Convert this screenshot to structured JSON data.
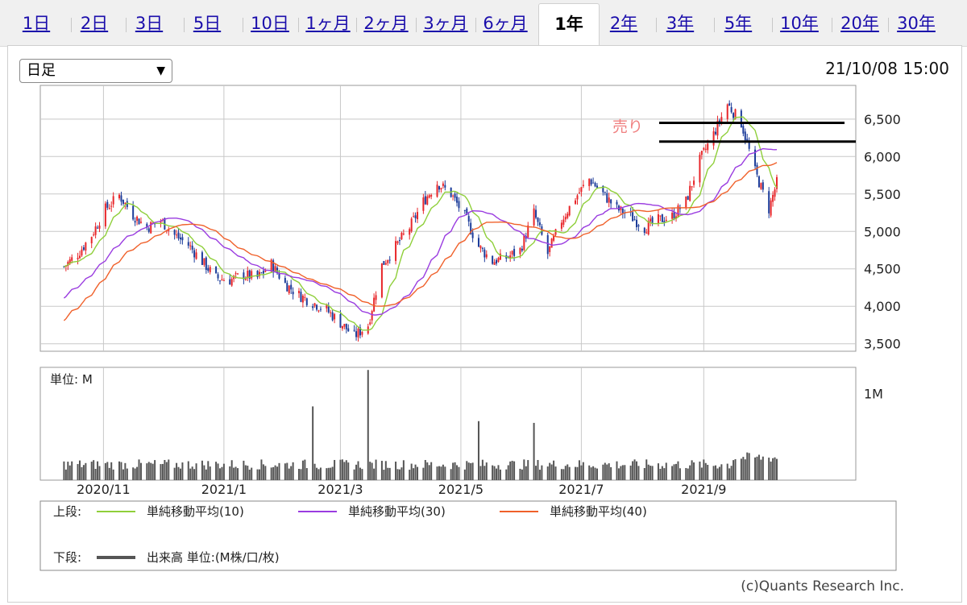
{
  "tabs": [
    "1日",
    "2日",
    "3日",
    "5日",
    "10日",
    "1ヶ月",
    "2ヶ月",
    "3ヶ月",
    "6ヶ月",
    "1年",
    "2年",
    "3年",
    "5年",
    "10年",
    "20年",
    "30年"
  ],
  "active_tab": "1年",
  "period_select": "日足",
  "timestamp": "21/10/08 15:00",
  "copyright": "(c)Quants Research Inc.",
  "colors": {
    "up": "#e8262a",
    "down": "#1c3c9a",
    "ma10": "#8fcf3a",
    "ma30": "#9a3ce0",
    "ma40": "#f0602a",
    "volume": "#555555",
    "annotation": "#f08080"
  },
  "chart_data": {
    "type": "candlestick",
    "price": {
      "ylim": [
        3400,
        6950
      ],
      "yticks": [
        3500,
        4000,
        4500,
        5000,
        5500,
        6000,
        6500
      ],
      "ytick_labels": [
        "3,500",
        "4,000",
        "4,500",
        "5,000",
        "5,500",
        "6,000",
        "6,500"
      ],
      "close_series": [
        [
          "2020-10-12",
          4530
        ],
        [
          "2020-10-19",
          4700
        ],
        [
          "2020-10-26",
          4950
        ],
        [
          "2020-11-02",
          5300
        ],
        [
          "2020-11-09",
          5480
        ],
        [
          "2020-11-16",
          5220
        ],
        [
          "2020-11-23",
          5050
        ],
        [
          "2020-11-30",
          5150
        ],
        [
          "2020-12-07",
          4950
        ],
        [
          "2020-12-14",
          4820
        ],
        [
          "2020-12-21",
          4600
        ],
        [
          "2020-12-28",
          4380
        ],
        [
          "2021-01-04",
          4350
        ],
        [
          "2021-01-11",
          4420
        ],
        [
          "2021-01-18",
          4380
        ],
        [
          "2021-01-25",
          4560
        ],
        [
          "2021-02-01",
          4300
        ],
        [
          "2021-02-08",
          4150
        ],
        [
          "2021-02-15",
          4050
        ],
        [
          "2021-02-22",
          3950
        ],
        [
          "2021-03-01",
          3780
        ],
        [
          "2021-03-08",
          3600
        ],
        [
          "2021-03-15",
          3750
        ],
        [
          "2021-03-22",
          4550
        ],
        [
          "2021-03-29",
          4800
        ],
        [
          "2021-04-05",
          5050
        ],
        [
          "2021-04-12",
          5400
        ],
        [
          "2021-04-19",
          5650
        ],
        [
          "2021-04-26",
          5500
        ],
        [
          "2021-05-03",
          5200
        ],
        [
          "2021-05-10",
          4800
        ],
        [
          "2021-05-17",
          4600
        ],
        [
          "2021-05-24",
          4650
        ],
        [
          "2021-05-31",
          4750
        ],
        [
          "2021-06-07",
          5250
        ],
        [
          "2021-06-14",
          4700
        ],
        [
          "2021-06-21",
          5150
        ],
        [
          "2021-06-28",
          5450
        ],
        [
          "2021-07-05",
          5700
        ],
        [
          "2021-07-12",
          5500
        ],
        [
          "2021-07-19",
          5300
        ],
        [
          "2021-07-26",
          5200
        ],
        [
          "2021-08-02",
          5050
        ],
        [
          "2021-08-09",
          5150
        ],
        [
          "2021-08-16",
          5200
        ],
        [
          "2021-08-23",
          5400
        ],
        [
          "2021-08-30",
          5950
        ],
        [
          "2021-09-06",
          6300
        ],
        [
          "2021-09-13",
          6700
        ],
        [
          "2021-09-20",
          6450
        ],
        [
          "2021-09-27",
          5800
        ],
        [
          "2021-10-04",
          5300
        ],
        [
          "2021-10-08",
          5650
        ]
      ],
      "ma_series": [
        {
          "name": "単純移動平均(10)",
          "period": 10,
          "color": "#8fcf3a"
        },
        {
          "name": "単純移動平均(30)",
          "period": 30,
          "color": "#9a3ce0"
        },
        {
          "name": "単純移動平均(40)",
          "period": 40,
          "color": "#f0602a"
        }
      ],
      "resistance_lines": [
        6450,
        6200
      ],
      "annotation": "売り"
    },
    "volume": {
      "unit_label": "単位: M",
      "ytick_label": "1M",
      "ylim": [
        0,
        1300000
      ],
      "spikes": [
        [
          "2021-02-15",
          850000
        ],
        [
          "2021-03-15",
          1270000
        ],
        [
          "2021-05-10",
          680000
        ],
        [
          "2021-06-07",
          660000
        ]
      ]
    },
    "x_labels": [
      [
        "2020-11-01",
        "2020/11"
      ],
      [
        "2021-01-01",
        "2021/1"
      ],
      [
        "2021-03-01",
        "2021/3"
      ],
      [
        "2021-05-01",
        "2021/5"
      ],
      [
        "2021-07-01",
        "2021/7"
      ],
      [
        "2021-09-01",
        "2021/9"
      ]
    ],
    "legend": {
      "upper_label": "上段:",
      "lower_label": "下段:",
      "upper_items": [
        "単純移動平均(10)",
        "単純移動平均(30)",
        "単純移動平均(40)"
      ],
      "lower_item": "出来高 単位:(M株/口/枚)"
    }
  }
}
